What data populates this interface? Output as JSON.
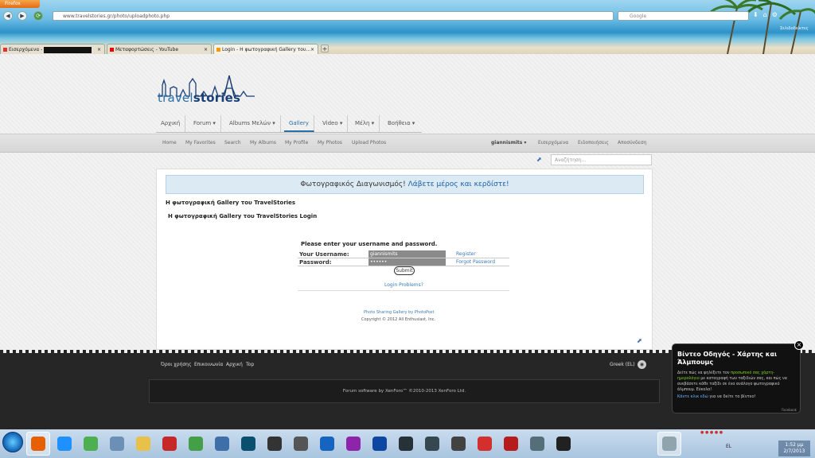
{
  "browser": {
    "firefox_button": "Firefox",
    "url": "www.travelstories.gr/photo/uploadphoto.php",
    "search_placeholder": "Google",
    "tabs": [
      {
        "label": "Εισερχόμενα - ",
        "active": false
      },
      {
        "label": "Μεταφορτώσεις - YouTube",
        "active": false
      },
      {
        "label": "Login - Η φωτογραφική Gallery του...",
        "active": true
      }
    ],
    "new_tab": "+",
    "toolbar_label": "Σελιδοδείκτες"
  },
  "site": {
    "logo_light": "travel",
    "logo_bold": "stories",
    "nav": [
      {
        "label": "Αρχική",
        "dropdown": false
      },
      {
        "label": "Forum",
        "dropdown": true
      },
      {
        "label": "Albums Μελών",
        "dropdown": true
      },
      {
        "label": "Gallery",
        "dropdown": false,
        "selected": true
      },
      {
        "label": "Video",
        "dropdown": true
      },
      {
        "label": "Μέλη",
        "dropdown": true
      },
      {
        "label": "Βοήθεια",
        "dropdown": true
      }
    ],
    "subnav": [
      "Home",
      "My Favorites",
      "Search",
      "My Albums",
      "My Profile",
      "My Photos",
      "Upload Photos"
    ],
    "user_links": [
      "giannismits",
      "Εισερχόμενα",
      "Ειδοποιήσεις",
      "Αποσύνδεση"
    ],
    "search_placeholder": "Αναζήτηση..."
  },
  "content": {
    "banner_text": "Φωτογραφικός Διαγωνισμός! ",
    "banner_link": "Λάβετε μέρος και κερδίστε!",
    "heading1": "Η φωτογραφική Gallery του TravelStories",
    "heading2": "Η φωτογραφική Gallery του TravelStories Login",
    "login_prompt": "Please enter your username and password.",
    "username_label": "Your Username:",
    "username_value": "giannismits",
    "password_label": "Password:",
    "password_value": "••••••",
    "register_link": "Register",
    "forgot_link": "Forgot Password",
    "submit_label": "Submit",
    "login_problems": "Login Problems?",
    "credit_link": "Photo Sharing Gallery by PhotoPost",
    "copyright": "Copyright © 2012 All Enthusiast, Inc."
  },
  "footer": {
    "links": [
      "Όροι χρήσης",
      "Επικοινωνία",
      "Αρχική",
      "Top"
    ],
    "language": "Greek (EL)",
    "forum_software": "Forum software by XenForo™ ©2010-2013 XenForo Ltd."
  },
  "popup": {
    "title": "Βίντεο Οδηγός - Χάρτης και Άλμπουμς",
    "body_1": "Δείτε πώς να ψηλέξετε τον ",
    "body_green": "προσωπικό σας χάρτη-ημερολόγιο",
    "body_2": " με καταγραφή των ταξιδιών σας, και πώς να ανεβάσετε κάθε ταξίδι σε ένα ανάλογο φωτογραφικό άλμπουμ. Εύκολα!",
    "link_text": "Κάντε κλικ εδώ",
    "link_rest": " για να δείτε το βίντεο!",
    "tiny": "Facebook",
    "close": "×"
  },
  "taskbar": {
    "apps": [
      {
        "name": "firefox",
        "color": "#e66000",
        "active": true
      },
      {
        "name": "internet-explorer",
        "color": "#1e90ff",
        "active": false
      },
      {
        "name": "chrome",
        "color": "#4caf50",
        "active": false
      },
      {
        "name": "network",
        "color": "#6b8fb5",
        "active": false
      },
      {
        "name": "folder",
        "color": "#e8c14a",
        "active": false
      },
      {
        "name": "app-red",
        "color": "#c62828",
        "active": false
      },
      {
        "name": "utorrent",
        "color": "#43a047",
        "active": false
      },
      {
        "name": "app-blue",
        "color": "#3f6fa8",
        "active": false
      },
      {
        "name": "media",
        "color": "#0a4f6e",
        "active": false
      },
      {
        "name": "football",
        "color": "#333333",
        "active": false
      },
      {
        "name": "hp",
        "color": "#555555",
        "active": false
      },
      {
        "name": "google-earth",
        "color": "#1565c0",
        "active": false
      },
      {
        "name": "picasa",
        "color": "#8e24aa",
        "active": false
      },
      {
        "name": "photoshop",
        "color": "#0d47a1",
        "active": false
      },
      {
        "name": "app-dark",
        "color": "#263238",
        "active": false
      },
      {
        "name": "lightroom",
        "color": "#37474f",
        "active": false
      },
      {
        "name": "app-gray",
        "color": "#424242",
        "active": false
      },
      {
        "name": "app-red2",
        "color": "#d32f2f",
        "active": false
      },
      {
        "name": "app-flag",
        "color": "#b71c1c",
        "active": false
      },
      {
        "name": "app-ball",
        "color": "#546e7a",
        "active": false
      },
      {
        "name": "app-monitor",
        "color": "#212121",
        "active": false
      },
      {
        "name": "app-current",
        "color": "#90a4ae",
        "active": true
      }
    ],
    "tray_lang": "EL",
    "clock_time": "1:52 μμ",
    "clock_date": "2/7/2013"
  }
}
